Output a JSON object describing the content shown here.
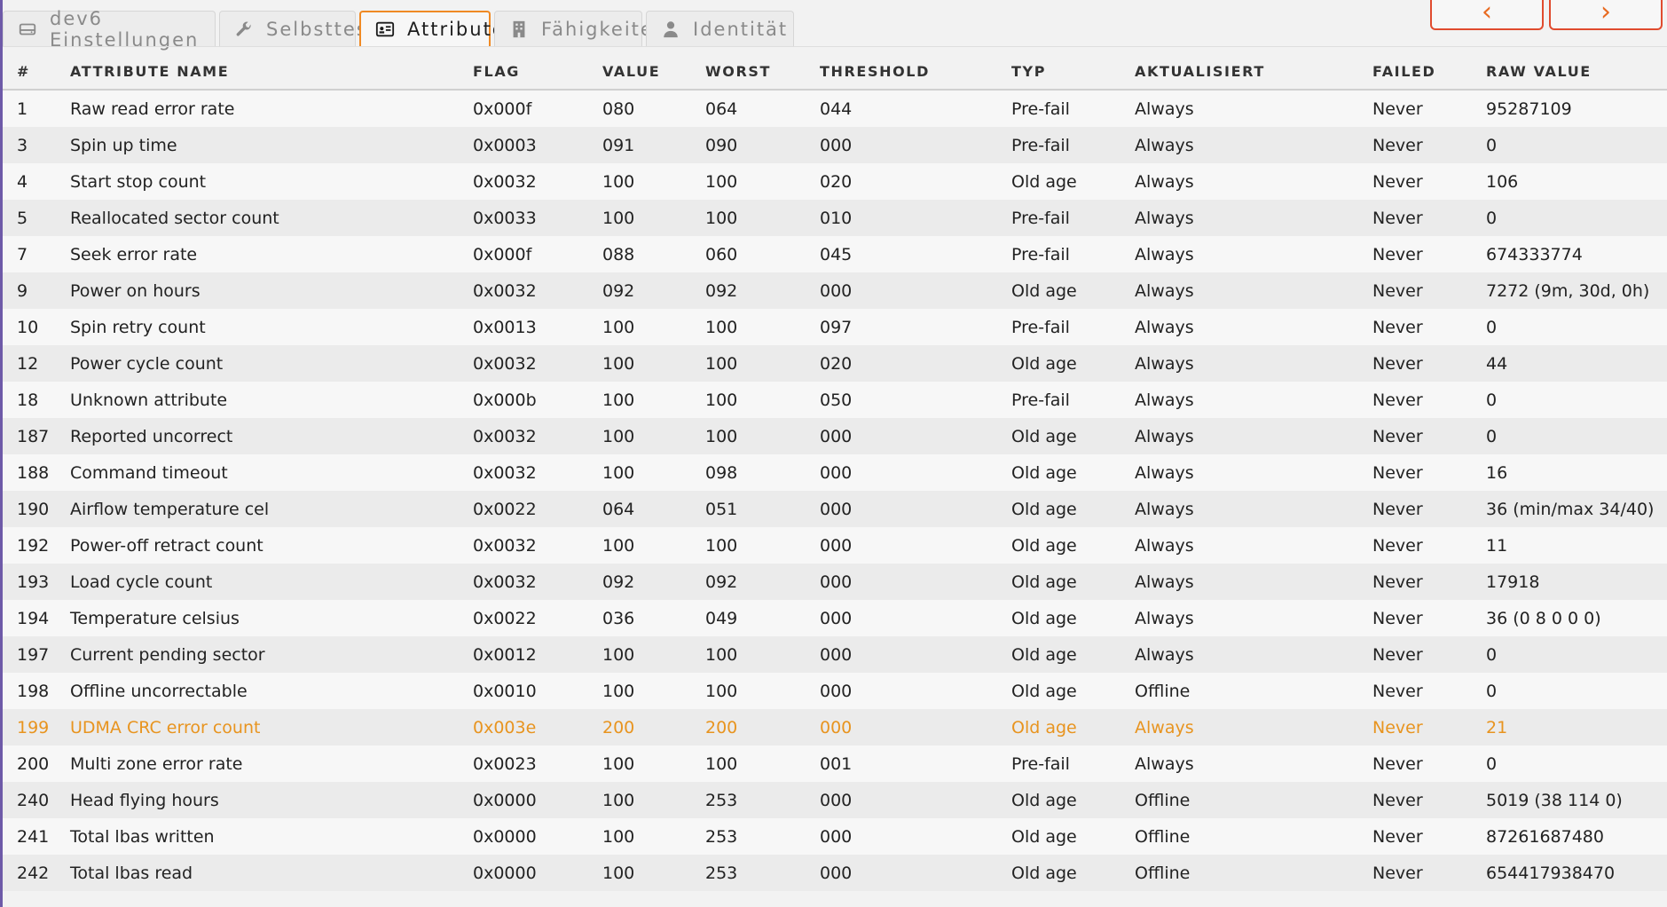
{
  "tabs": [
    {
      "label": "dev6 Einstellungen",
      "icon": "drive-icon",
      "active": false
    },
    {
      "label": "Selbsttest",
      "icon": "wrench-icon",
      "active": false
    },
    {
      "label": "Attribute",
      "icon": "id-card-icon",
      "active": true
    },
    {
      "label": "Fähigkeiten",
      "icon": "building-icon",
      "active": false
    },
    {
      "label": "Identität",
      "icon": "user-icon",
      "active": false
    }
  ],
  "nav": {
    "prev_icon": "chevron-left-icon",
    "next_icon": "chevron-right-icon",
    "prev": "‹",
    "next": "›"
  },
  "table": {
    "headers": [
      "#",
      "ATTRIBUTE NAME",
      "FLAG",
      "VALUE",
      "WORST",
      "THRESHOLD",
      "TYP",
      "AKTUALISIERT",
      "FAILED",
      "RAW VALUE"
    ],
    "rows": [
      [
        "1",
        "Raw read error rate",
        "0x000f",
        "080",
        "064",
        "044",
        "Pre-fail",
        "Always",
        "Never",
        "95287109"
      ],
      [
        "3",
        "Spin up time",
        "0x0003",
        "091",
        "090",
        "000",
        "Pre-fail",
        "Always",
        "Never",
        "0"
      ],
      [
        "4",
        "Start stop count",
        "0x0032",
        "100",
        "100",
        "020",
        "Old age",
        "Always",
        "Never",
        "106"
      ],
      [
        "5",
        "Reallocated sector count",
        "0x0033",
        "100",
        "100",
        "010",
        "Pre-fail",
        "Always",
        "Never",
        "0"
      ],
      [
        "7",
        "Seek error rate",
        "0x000f",
        "088",
        "060",
        "045",
        "Pre-fail",
        "Always",
        "Never",
        "674333774"
      ],
      [
        "9",
        "Power on hours",
        "0x0032",
        "092",
        "092",
        "000",
        "Old age",
        "Always",
        "Never",
        "7272 (9m, 30d, 0h)"
      ],
      [
        "10",
        "Spin retry count",
        "0x0013",
        "100",
        "100",
        "097",
        "Pre-fail",
        "Always",
        "Never",
        "0"
      ],
      [
        "12",
        "Power cycle count",
        "0x0032",
        "100",
        "100",
        "020",
        "Old age",
        "Always",
        "Never",
        "44"
      ],
      [
        "18",
        "Unknown attribute",
        "0x000b",
        "100",
        "100",
        "050",
        "Pre-fail",
        "Always",
        "Never",
        "0"
      ],
      [
        "187",
        "Reported uncorrect",
        "0x0032",
        "100",
        "100",
        "000",
        "Old age",
        "Always",
        "Never",
        "0"
      ],
      [
        "188",
        "Command timeout",
        "0x0032",
        "100",
        "098",
        "000",
        "Old age",
        "Always",
        "Never",
        "16"
      ],
      [
        "190",
        "Airflow temperature cel",
        "0x0022",
        "064",
        "051",
        "000",
        "Old age",
        "Always",
        "Never",
        "36 (min/max 34/40)"
      ],
      [
        "192",
        "Power-off retract count",
        "0x0032",
        "100",
        "100",
        "000",
        "Old age",
        "Always",
        "Never",
        "11"
      ],
      [
        "193",
        "Load cycle count",
        "0x0032",
        "092",
        "092",
        "000",
        "Old age",
        "Always",
        "Never",
        "17918"
      ],
      [
        "194",
        "Temperature celsius",
        "0x0022",
        "036",
        "049",
        "000",
        "Old age",
        "Always",
        "Never",
        "36 (0 8 0 0 0)"
      ],
      [
        "197",
        "Current pending sector",
        "0x0012",
        "100",
        "100",
        "000",
        "Old age",
        "Always",
        "Never",
        "0"
      ],
      [
        "198",
        "Offline uncorrectable",
        "0x0010",
        "100",
        "100",
        "000",
        "Old age",
        "Offline",
        "Never",
        "0"
      ],
      [
        "199",
        "UDMA CRC error count",
        "0x003e",
        "200",
        "200",
        "000",
        "Old age",
        "Always",
        "Never",
        "21"
      ],
      [
        "200",
        "Multi zone error rate",
        "0x0023",
        "100",
        "100",
        "001",
        "Pre-fail",
        "Always",
        "Never",
        "0"
      ],
      [
        "240",
        "Head flying hours",
        "0x0000",
        "100",
        "253",
        "000",
        "Old age",
        "Offline",
        "Never",
        "5019 (38 114 0)"
      ],
      [
        "241",
        "Total lbas written",
        "0x0000",
        "100",
        "253",
        "000",
        "Old age",
        "Offline",
        "Never",
        "87261687480"
      ],
      [
        "242",
        "Total lbas read",
        "0x0000",
        "100",
        "253",
        "000",
        "Old age",
        "Offline",
        "Never",
        "654417938470"
      ]
    ],
    "warning_row_index": 17,
    "warning_color": "#e8941f"
  },
  "colors": {
    "accent": "#f08a24",
    "nav_border": "#e04b2e",
    "sidebar": "#6e5aa8"
  }
}
